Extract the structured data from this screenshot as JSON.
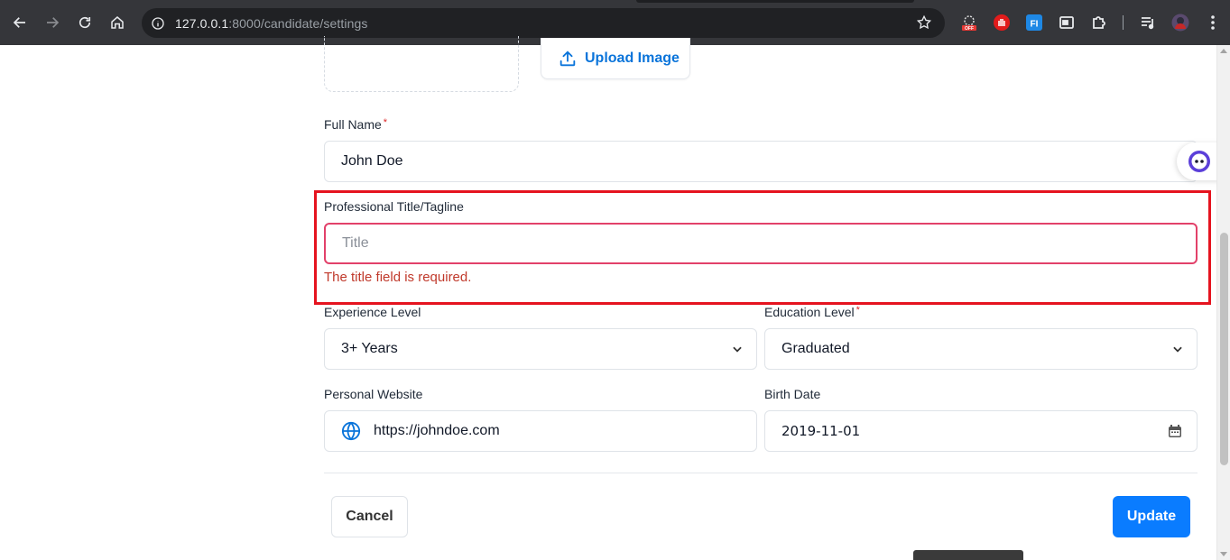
{
  "browser": {
    "url_host": "127.0.0.1",
    "url_path": ":8000/candidate/settings"
  },
  "upload": {
    "label": "Upload Image"
  },
  "form": {
    "full_name": {
      "label": "Full Name",
      "required_mark": "*",
      "value": "John Doe"
    },
    "title": {
      "label": "Professional Title/Tagline",
      "placeholder": "Title",
      "error": "The title field is required."
    },
    "experience": {
      "label": "Experience Level",
      "value": "3+ Years"
    },
    "education": {
      "label": "Education Level",
      "required_mark": "*",
      "value": "Graduated"
    },
    "website": {
      "label": "Personal Website",
      "value": "https://johndoe.com"
    },
    "birth_date": {
      "label": "Birth Date",
      "value": "2019-11-01"
    }
  },
  "actions": {
    "cancel": "Cancel",
    "update": "Update"
  },
  "colors": {
    "accent": "#0a7cff",
    "error": "#c0392b",
    "highlight": "#e5131f"
  }
}
